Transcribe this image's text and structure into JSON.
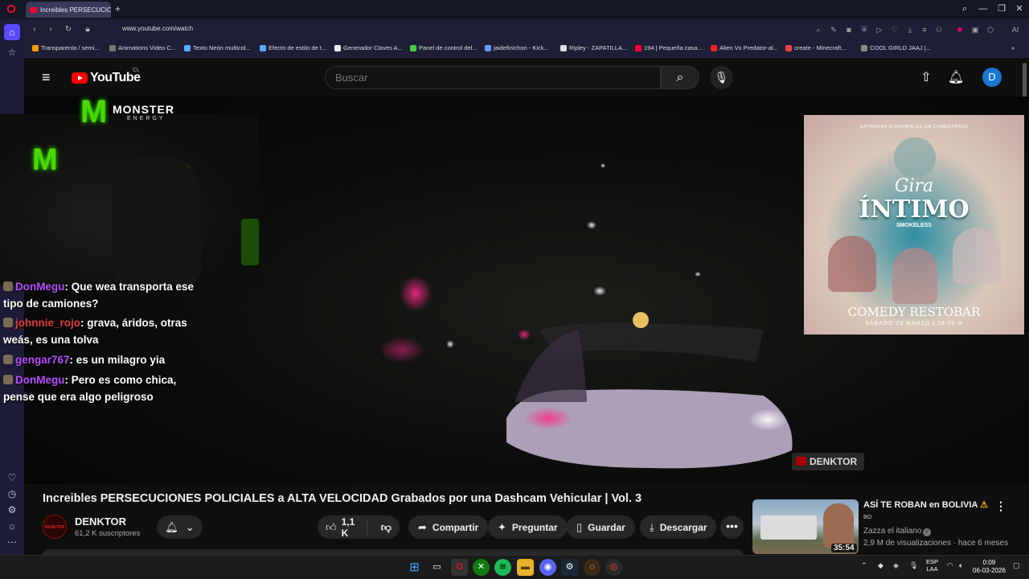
{
  "browser": {
    "tab_title": "Increibles PERSECUCIO",
    "url": "www.youtube.com/watch",
    "ai_label": "AI",
    "bookmarks": [
      "Transparenta / semi...",
      "Animations Video C...",
      "Texto Neón multicol...",
      "Efecto de estilo de t...",
      "Generador Claves A...",
      "Panel de control del...",
      "jaidefinichon - Kick...",
      "Ripley - ZAPATILLA...",
      "194 | Pequeña casa...",
      "Alien Vs Predator-al...",
      "create - Minecraft...",
      "COOL GIRLD JAAJ |..."
    ]
  },
  "youtube": {
    "logo_text": "YouTube",
    "country": "CL",
    "search_placeholder": "Buscar",
    "avatar_letter": "D"
  },
  "overlay": {
    "brand": "MONSTER",
    "brand_sub": "ENERGY",
    "chat": [
      {
        "user": "DonMegu",
        "msg": ": Que wea transporta ese tipo de camiones?"
      },
      {
        "user": "johnnie_rojo",
        "msg": ": grava, áridos, otras weás, es una tolva"
      },
      {
        "user": "gengar767",
        "msg": ": es un milagro yia"
      },
      {
        "user": "DonMegu",
        "msg": ": Pero es como chica, pense que era algo peligroso"
      }
    ],
    "ad": {
      "top_line": "ENTRADAS DISPONIBLES EN COMEDYPASS",
      "tour": "Gira",
      "title": "ÍNTIMO",
      "by": "SMOKELESS",
      "venue": "COMEDY RESTOBAR",
      "date": "SÁBADO 28 MARZO | 18:00 H"
    },
    "watermark": "DENKTOR"
  },
  "video": {
    "title": "Increibles PERSECUCIONES POLICIALES a ALTA VELOCIDAD Grabados por una Dashcam Vehicular | Vol. 3",
    "channel": "DENKTOR",
    "subscribers": "61,2 K suscriptores",
    "likes": "1,1 K",
    "actions": {
      "share": "Compartir",
      "ask": "Preguntar",
      "save": "Guardar",
      "download": "Descargar"
    }
  },
  "recommended": {
    "title": "ASÍ TE ROBAN en BOLIVIA",
    "thumb_text": "BO",
    "channel": "Zazza el italiano",
    "meta": "2,9 M de visualizaciones · hace 6 meses",
    "duration": "35:54"
  },
  "taskbar": {
    "lang_1": "ESP",
    "lang_2": "LAA",
    "time": "0:09",
    "date": "06-03-2026"
  }
}
